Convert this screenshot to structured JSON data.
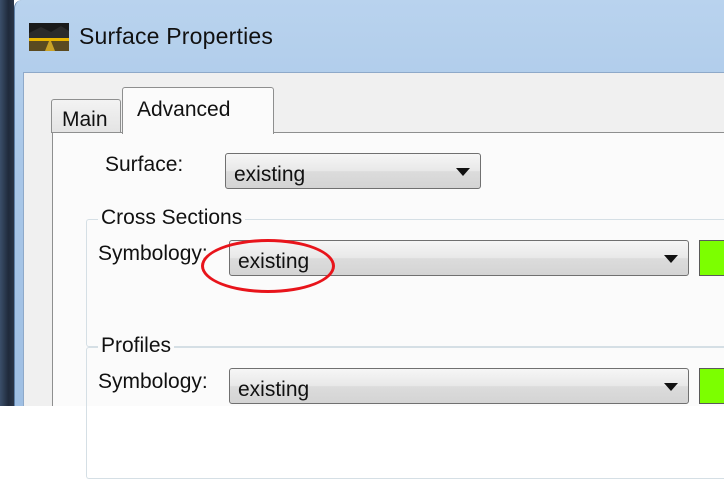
{
  "window": {
    "title": "Surface Properties",
    "icon": "surface-landscape-icon"
  },
  "tabs": [
    {
      "label": "Main",
      "active": false
    },
    {
      "label": "Advanced",
      "active": true
    }
  ],
  "surface": {
    "label": "Surface:",
    "value": "existing"
  },
  "cross_sections": {
    "group_label": "Cross Sections",
    "symbology_label": "Symbology:",
    "symbology_value": "existing",
    "swatch_color": "#7cff00"
  },
  "profiles": {
    "group_label": "Profiles",
    "symbology_label": "Symbology:",
    "symbology_value": "existing",
    "swatch_color": "#7cff00"
  },
  "annotation": {
    "type": "red-ellipse-highlight",
    "color": "#e8141b"
  }
}
